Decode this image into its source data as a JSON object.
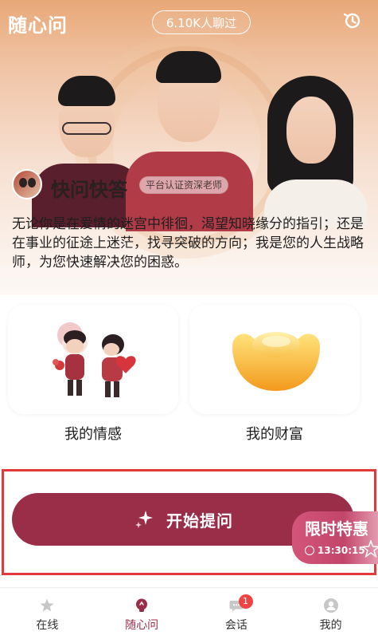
{
  "header": {
    "app_title": "随心问",
    "chat_count": "6.10K人聊过",
    "history_icon": "history-icon"
  },
  "expert": {
    "name": "快问快答",
    "badge": "平台认证资深老师",
    "intro": "无论你是在爱情的迷宫中徘徊，渴望知晓缘分的指引；还是在事业的征途上迷茫，找寻突破的方向；我是您的人生战略师，为您快速解决您的困惑。"
  },
  "categories": [
    {
      "label": "我的情感",
      "icon": "couple-illustration"
    },
    {
      "label": "我的财富",
      "icon": "gold-ingot-illustration"
    }
  ],
  "start_button": {
    "label": "开始提问",
    "icon": "sparkle-icon"
  },
  "promo": {
    "title": "限时特惠",
    "timer": "13:30:15"
  },
  "tabbar": {
    "items": [
      {
        "label": "在线",
        "icon": "star-icon",
        "active": false
      },
      {
        "label": "随心问",
        "icon": "bulb-icon",
        "active": true
      },
      {
        "label": "会话",
        "icon": "chat-icon",
        "active": false,
        "badge": "1"
      },
      {
        "label": "我的",
        "icon": "user-icon",
        "active": false
      }
    ]
  },
  "colors": {
    "accent": "#9a2d48",
    "promo": "#c2466a",
    "highlight_border": "#e23a3a",
    "badge": "#ef4444"
  }
}
